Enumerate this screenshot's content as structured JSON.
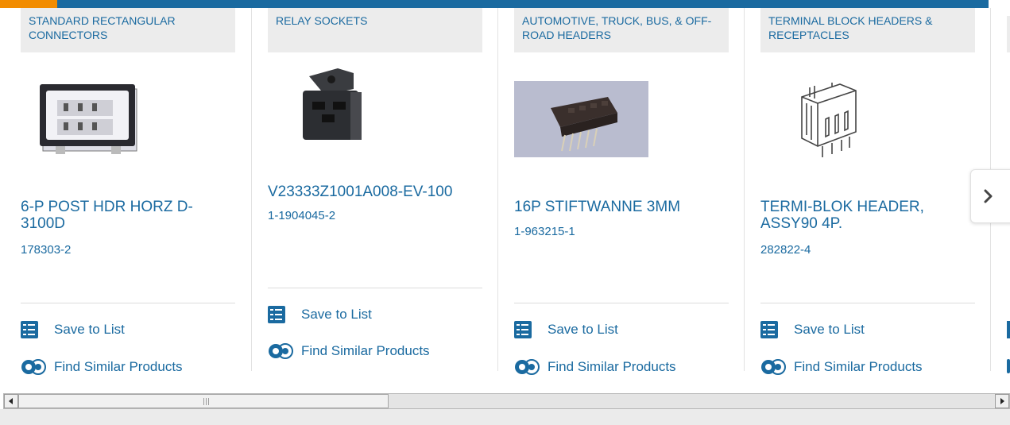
{
  "cards": [
    {
      "category": "STANDARD RECTANGULAR CONNECTORS",
      "title": "6-P POST HDR HORZ D-3100D",
      "part_number": "178303-2",
      "save_label": "Save to List",
      "similar_label": "Find Similar Products"
    },
    {
      "category": "RELAY SOCKETS",
      "title": "V23333Z1001A008-EV-100",
      "part_number": "1-1904045-2",
      "save_label": "Save to List",
      "similar_label": "Find Similar Products"
    },
    {
      "category": "AUTOMOTIVE, TRUCK, BUS, & OFF-ROAD HEADERS",
      "title": "16P STIFTWANNE 3MM",
      "part_number": "1-963215-1",
      "save_label": "Save to List",
      "similar_label": "Find Similar Products"
    },
    {
      "category": "TERMINAL BLOCK HEADERS & RECEPTACLES",
      "title": "TERMI-BLOK HEADER, ASSY90 4P.",
      "part_number": "282822-4",
      "save_label": "Save to List",
      "similar_label": "Find Similar Products"
    }
  ],
  "colors": {
    "link": "#1a6aa0",
    "accent": "#f28c00",
    "category_bg": "#ececec"
  },
  "icons": {
    "save": "checklist-icon",
    "similar": "find-similar-icon",
    "next": "chevron-right-icon"
  }
}
